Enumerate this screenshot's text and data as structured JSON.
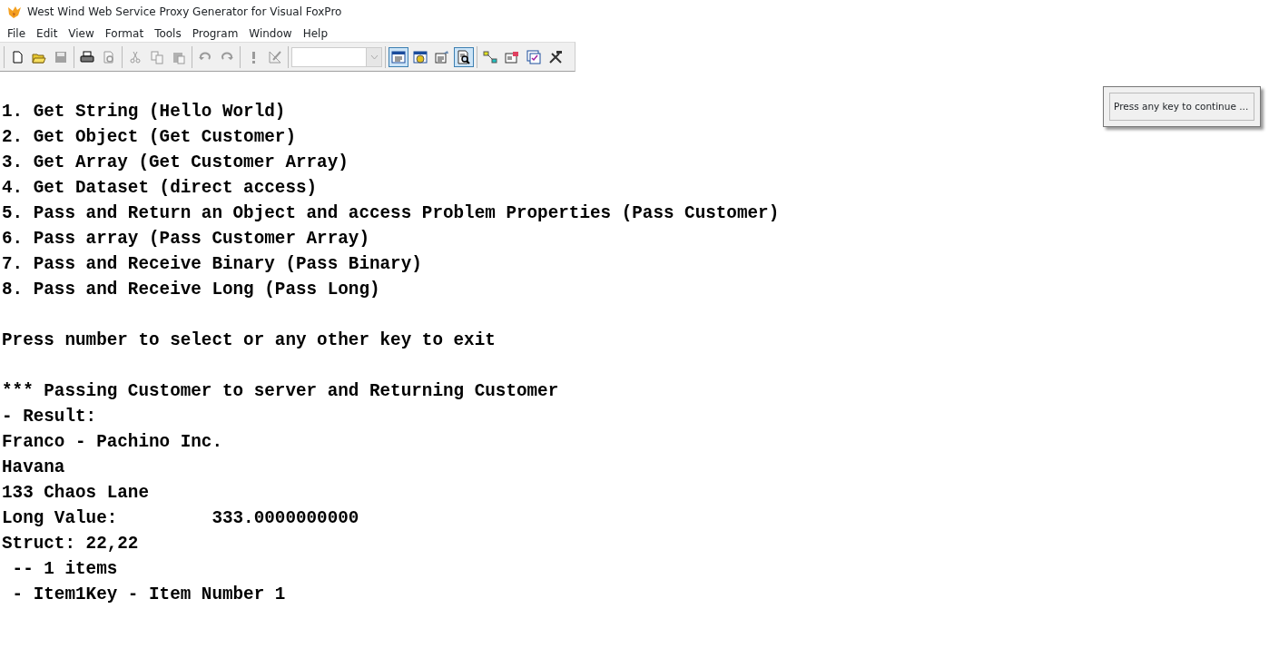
{
  "window": {
    "title": "West Wind Web Service Proxy Generator for Visual FoxPro"
  },
  "menu": [
    "File",
    "Edit",
    "View",
    "Format",
    "Tools",
    "Program",
    "Window",
    "Help"
  ],
  "toolbar": [
    [
      {
        "kind": "new",
        "disabled": false,
        "selected": false
      },
      {
        "kind": "open",
        "disabled": false,
        "selected": false
      },
      {
        "kind": "save",
        "disabled": true,
        "selected": false
      }
    ],
    [
      {
        "kind": "print",
        "disabled": false,
        "selected": false
      },
      {
        "kind": "preview",
        "disabled": true,
        "selected": false
      }
    ],
    [
      {
        "kind": "cut",
        "disabled": true,
        "selected": false
      },
      {
        "kind": "copy",
        "disabled": true,
        "selected": false
      },
      {
        "kind": "paste",
        "disabled": true,
        "selected": false
      }
    ],
    [
      {
        "kind": "undo",
        "disabled": true,
        "selected": false
      },
      {
        "kind": "redo",
        "disabled": true,
        "selected": false
      }
    ],
    [
      {
        "kind": "run",
        "disabled": true,
        "selected": false
      },
      {
        "kind": "wizard",
        "disabled": true,
        "selected": false
      }
    ],
    [
      {
        "kind": "combo",
        "disabled": true
      }
    ],
    [
      {
        "kind": "command",
        "disabled": false,
        "selected": true
      },
      {
        "kind": "database",
        "disabled": false,
        "selected": false
      },
      {
        "kind": "properties",
        "disabled": false,
        "selected": false
      },
      {
        "kind": "datasession",
        "disabled": false,
        "selected": true
      }
    ],
    [
      {
        "kind": "connections",
        "disabled": false,
        "selected": false
      },
      {
        "kind": "form",
        "disabled": false,
        "selected": false
      },
      {
        "kind": "report",
        "disabled": false,
        "selected": false
      },
      {
        "kind": "tools",
        "disabled": false,
        "selected": false
      }
    ]
  ],
  "console": [
    [
      "1. Get String (Hello World)",
      "2. Get Object (Get Customer)",
      "3. Get Array (Get Customer Array)",
      "4. Get Dataset (direct access)",
      "5. Pass and Return an Object and access Problem Properties (Pass Customer)",
      "6. Pass array (Pass Customer Array)",
      "7. Pass and Receive Binary (Pass Binary)",
      "8. Pass and Receive Long (Pass Long)"
    ],
    [
      "Press number to select or any other key to exit"
    ],
    [
      "*** Passing Customer to server and Returning Customer",
      "- Result:",
      "Franco - Pachino Inc.",
      "Havana",
      "133 Chaos Lane",
      "Long Value:         333.0000000000",
      "Struct: 22,22",
      " -- 1 items",
      " - Item1Key - Item Number 1"
    ]
  ],
  "wait_window": {
    "text": "Press any key to continue ..."
  }
}
